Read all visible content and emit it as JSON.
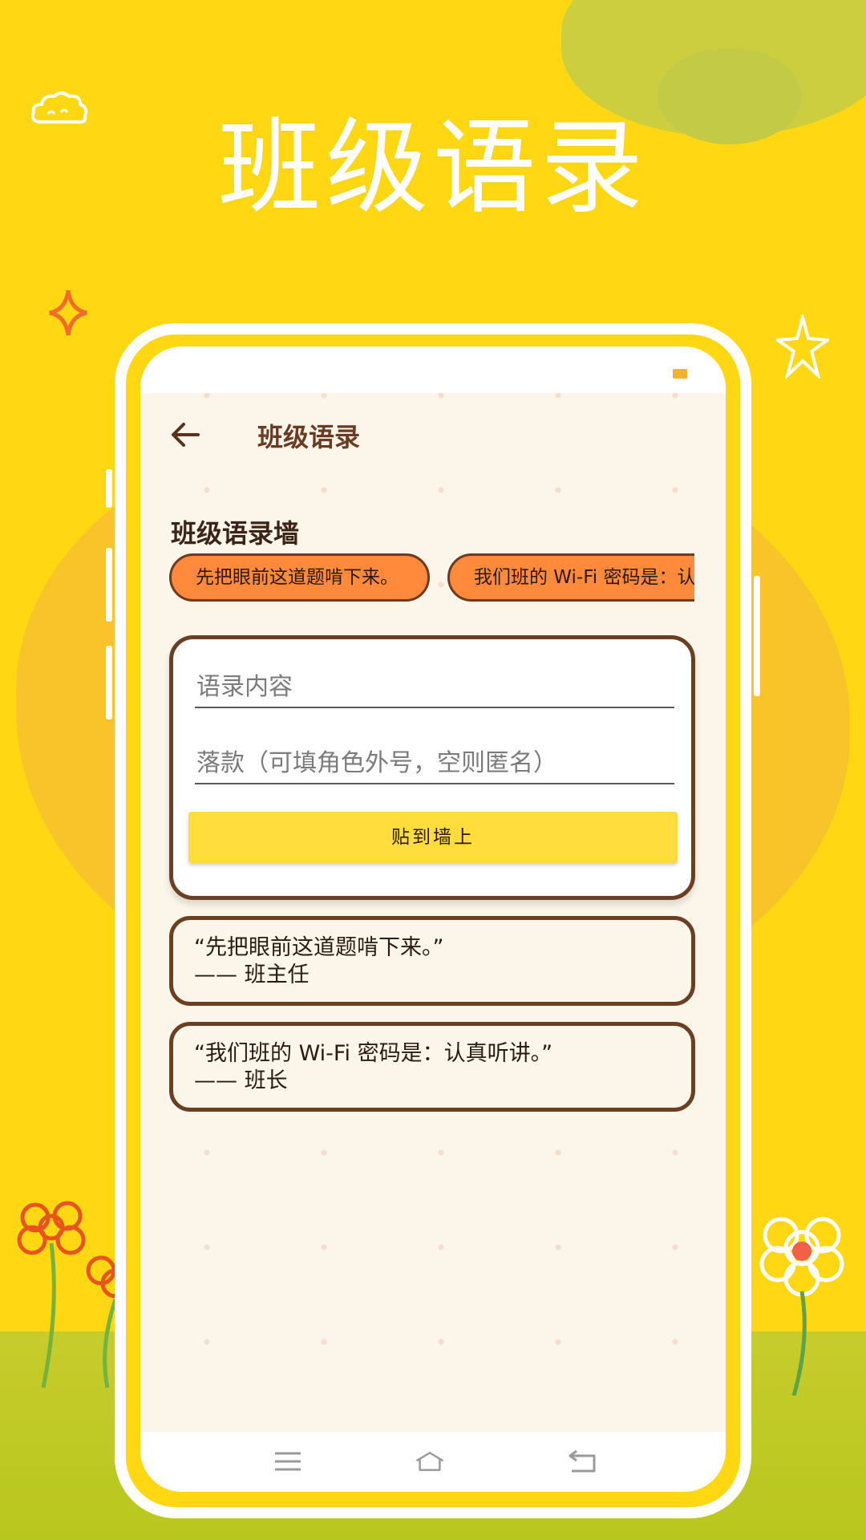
{
  "promo": {
    "headline": "班级语录"
  },
  "app": {
    "toolbar_title": "班级语录",
    "section_title": "班级语录墙",
    "chips": [
      "先把眼前这道题啃下来。",
      "我们班的 Wi-Fi 密码是：认真听讲。"
    ],
    "form": {
      "content_placeholder": "语录内容",
      "signature_placeholder": "落款（可填角色外号，空则匿名）",
      "post_button_label": "贴到墙上"
    },
    "quotes": [
      {
        "text": "“先把眼前这道题啃下来。”",
        "author": "—— 班主任"
      },
      {
        "text": "“我们班的 Wi-Fi 密码是：认真听讲。”",
        "author": "—— 班长"
      }
    ]
  },
  "icons": {
    "back": "arrow-left-icon",
    "nav_menu": "menu-icon",
    "nav_home": "home-icon",
    "nav_return": "return-icon"
  },
  "colors": {
    "background": "#ffd712",
    "chip": "#ff8a3c",
    "card_border": "#6b3f22",
    "button": "#ffdd3c",
    "title": "#6b3a22"
  }
}
